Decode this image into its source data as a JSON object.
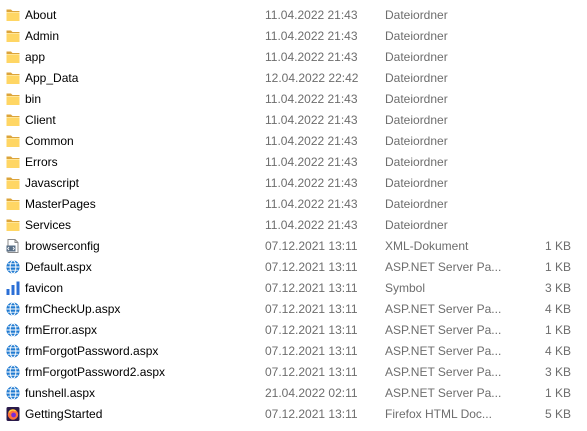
{
  "colors": {
    "name_text": "#000000",
    "meta_text": "#6d6d6d",
    "folder": "#ffd664",
    "globe": "#1f7ad1",
    "chart_icon": "#2b6fd6",
    "firefox": "#ff7139"
  },
  "files": [
    {
      "name": "About",
      "modified": "11.04.2022 21:43",
      "type": "Dateiordner",
      "icon": "folder-icon"
    },
    {
      "name": "Admin",
      "modified": "11.04.2022 21:43",
      "type": "Dateiordner",
      "icon": "folder-icon"
    },
    {
      "name": "app",
      "modified": "11.04.2022 21:43",
      "type": "Dateiordner",
      "icon": "folder-icon"
    },
    {
      "name": "App_Data",
      "modified": "12.04.2022 22:42",
      "type": "Dateiordner",
      "icon": "folder-icon"
    },
    {
      "name": "bin",
      "modified": "11.04.2022 21:43",
      "type": "Dateiordner",
      "icon": "folder-icon"
    },
    {
      "name": "Client",
      "modified": "11.04.2022 21:43",
      "type": "Dateiordner",
      "icon": "folder-icon"
    },
    {
      "name": "Common",
      "modified": "11.04.2022 21:43",
      "type": "Dateiordner",
      "icon": "folder-icon"
    },
    {
      "name": "Errors",
      "modified": "11.04.2022 21:43",
      "type": "Dateiordner",
      "icon": "folder-icon"
    },
    {
      "name": "Javascript",
      "modified": "11.04.2022 21:43",
      "type": "Dateiordner",
      "icon": "folder-icon"
    },
    {
      "name": "MasterPages",
      "modified": "11.04.2022 21:43",
      "type": "Dateiordner",
      "icon": "folder-icon"
    },
    {
      "name": "Services",
      "modified": "11.04.2022 21:43",
      "type": "Dateiordner",
      "icon": "folder-icon"
    },
    {
      "name": "browserconfig",
      "modified": "07.12.2021 13:11",
      "type": "XML-Dokument",
      "size": "1 KB",
      "icon": "xml-file-icon"
    },
    {
      "name": "Default.aspx",
      "modified": "07.12.2021 13:11",
      "type": "ASP.NET Server Pa...",
      "size": "1 KB",
      "icon": "globe-icon"
    },
    {
      "name": "favicon",
      "modified": "07.12.2021 13:11",
      "type": "Symbol",
      "size": "3 KB",
      "icon": "bar-chart-icon"
    },
    {
      "name": "frmCheckUp.aspx",
      "modified": "07.12.2021 13:11",
      "type": "ASP.NET Server Pa...",
      "size": "4 KB",
      "icon": "globe-icon"
    },
    {
      "name": "frmError.aspx",
      "modified": "07.12.2021 13:11",
      "type": "ASP.NET Server Pa...",
      "size": "1 KB",
      "icon": "globe-icon"
    },
    {
      "name": "frmForgotPassword.aspx",
      "modified": "07.12.2021 13:11",
      "type": "ASP.NET Server Pa...",
      "size": "4 KB",
      "icon": "globe-icon"
    },
    {
      "name": "frmForgotPassword2.aspx",
      "modified": "07.12.2021 13:11",
      "type": "ASP.NET Server Pa...",
      "size": "3 KB",
      "icon": "globe-icon"
    },
    {
      "name": "funshell.aspx",
      "modified": "21.04.2022 02:11",
      "type": "ASP.NET Server Pa...",
      "size": "1 KB",
      "icon": "globe-icon"
    },
    {
      "name": "GettingStarted",
      "modified": "07.12.2021 13:11",
      "type": "Firefox HTML Doc...",
      "size": "5 KB",
      "icon": "firefox-icon"
    }
  ]
}
